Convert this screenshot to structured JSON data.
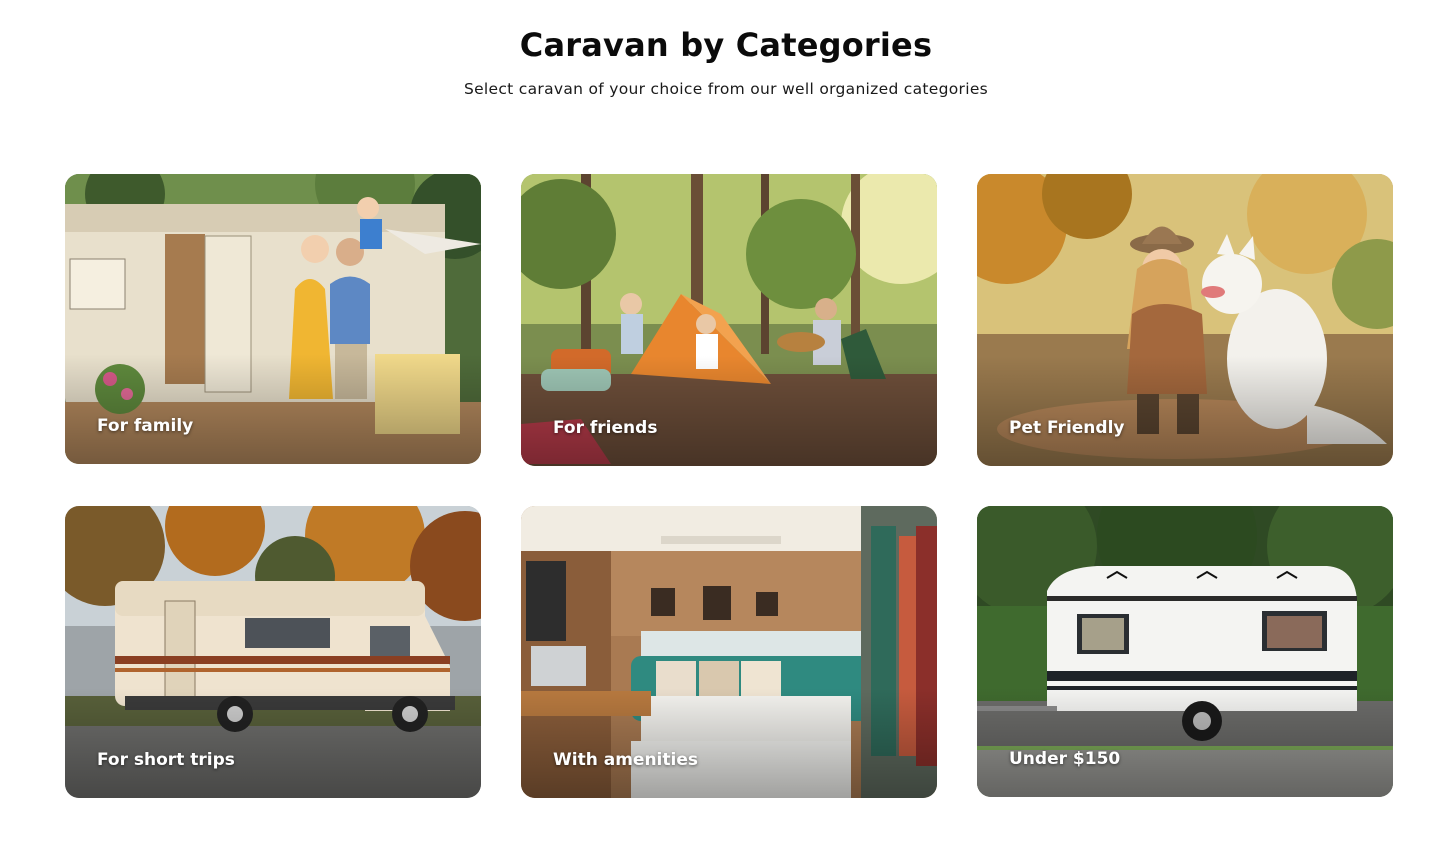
{
  "header": {
    "title": "Caravan by Categories",
    "subtitle": "Select caravan of your choice from our well organized categories"
  },
  "categories": [
    {
      "label": "For family"
    },
    {
      "label": "For friends"
    },
    {
      "label": "Pet Friendly"
    },
    {
      "label": "For short trips"
    },
    {
      "label": "With amenities"
    },
    {
      "label": "Under $150"
    }
  ]
}
